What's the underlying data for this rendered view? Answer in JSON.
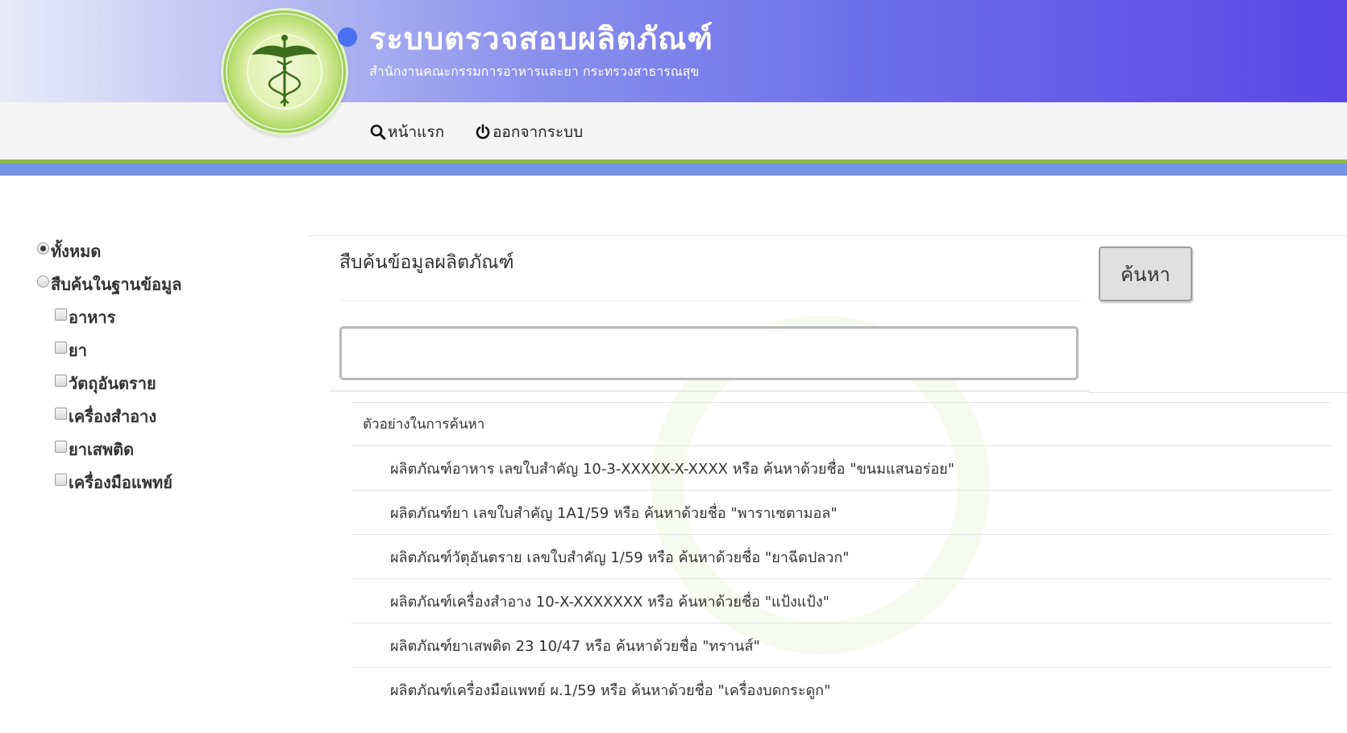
{
  "header": {
    "title": "ระบบตรวจสอบผลิตภัณฑ์",
    "subtitle": "สำนักงานคณะกรรมการอาหารและยา กระทรวงสาธารณสุข",
    "logo_icon": "caduceus-emblem-icon",
    "colors": {
      "gradient_start": "#e9ebf9",
      "gradient_end": "#5b46e6",
      "accent_green": "#8ab94c",
      "accent_blue": "#7593e6"
    }
  },
  "nav": {
    "home": {
      "label": "หน้าแรก",
      "icon": "search-icon"
    },
    "logout": {
      "label": "ออกจากระบบ",
      "icon": "power-icon"
    }
  },
  "sidebar": {
    "radio_all": {
      "label": "ทั้งหมด",
      "checked": true
    },
    "radio_db": {
      "label": "สืบค้นในฐานข้อมูล",
      "checked": false
    },
    "categories": [
      {
        "label": "อาหาร",
        "checked": false
      },
      {
        "label": "ยา",
        "checked": false
      },
      {
        "label": "วัตถุอันตราย",
        "checked": false
      },
      {
        "label": "เครื่องสำอาง",
        "checked": false
      },
      {
        "label": "ยาเสพติด",
        "checked": false
      },
      {
        "label": "เครื่องมือแพทย์",
        "checked": false
      }
    ]
  },
  "main": {
    "heading": "สืบค้นข้อมูลผลิตภัณฑ์",
    "search_button": "ค้นหา",
    "search_value": "",
    "examples_header": "ตัวอย่างในการค้นหา",
    "examples": [
      "ผลิตภัณฑ์อาหาร เลขใบสำคัญ 10-3-XXXXX-X-XXXX หรือ ค้นหาด้วยชื่อ  \"ขนมแสนอร่อย\"",
      "ผลิตภัณฑ์ยา เลขใบสำคัญ 1A1/59 หรือ ค้นหาด้วยชื่อ \"พาราเซตามอล\"",
      "ผลิตภัณฑ์วัตุอันตราย เลขใบสำคัญ 1/59 หรือ ค้นหาด้วยชื่อ \"ยาฉีดปลวก\"",
      "ผลิตภัณฑ์เครื่องสำอาง 10-X-XXXXXXX หรือ ค้นหาด้วยชื่อ \"แป้งแป้ง\"",
      "ผลิตภัณฑ์ยาเสพติด 23 10/47 หรือ ค้นหาด้วยชื่อ \"ทรานส์\"",
      "ผลิตภัณฑ์เครื่องมือแพทย์ ผ.1/59 หรือ ค้นหาด้วยชื่อ \"เครื่องบดกระดูก\""
    ]
  }
}
